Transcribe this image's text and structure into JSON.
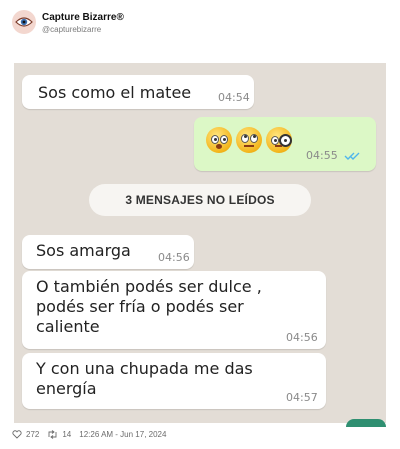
{
  "post": {
    "author_name": "Capture Bizarre®",
    "author_handle": "@capturebizarre"
  },
  "chat": {
    "messages": [
      {
        "text": "Sos como el matee",
        "time": "04:54"
      },
      {
        "text": "",
        "time": "04:55",
        "emojis": [
          "flushed-face-icon",
          "face-with-rolling-eyes-icon",
          "face-with-monocle-icon"
        ]
      },
      {
        "text": "Sos amarga",
        "time": "04:56"
      },
      {
        "line1": "O también podés ser dulce ,",
        "line2": "podés ser  fría o podés ser",
        "line3": "caliente",
        "time": "04:56"
      },
      {
        "line1": "Y con una chupada me das",
        "line2": "energía",
        "time": "04:57"
      }
    ],
    "unread_banner": "3 MENSAJES NO LEÍDOS"
  },
  "footer": {
    "likes": "272",
    "retweets": "14",
    "timestamp": "12:26 AM - Jun 17, 2024"
  },
  "colors": {
    "chat_bg": "#e3ddd6",
    "outgoing_bubble": "#dcf8c6",
    "read_ticks": "#4fb6ec"
  }
}
